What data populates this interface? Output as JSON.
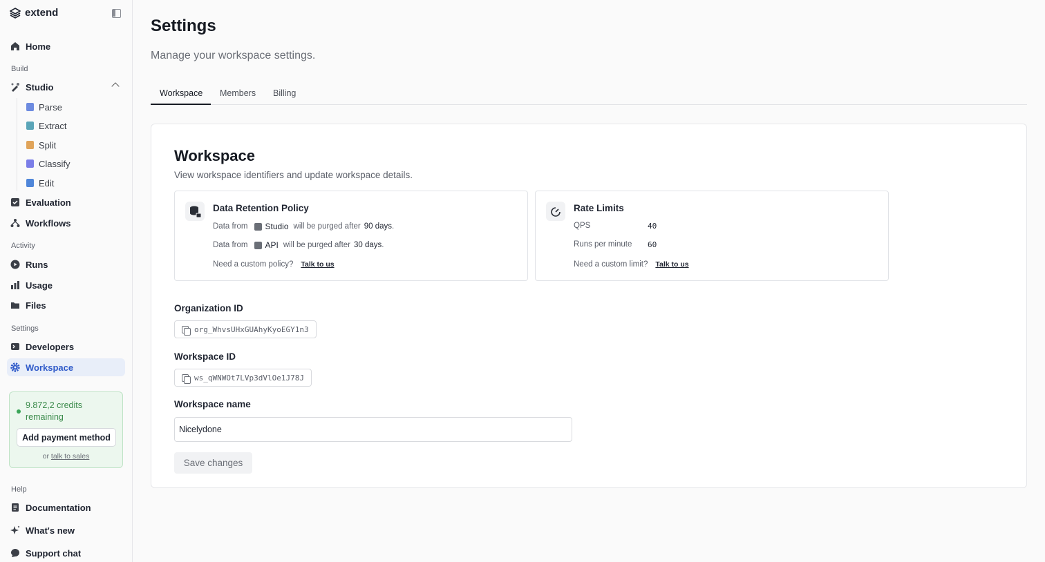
{
  "sidebar": {
    "brand": "extend",
    "items": {
      "home": "Home",
      "build_label": "Build",
      "studio": "Studio",
      "parse": "Parse",
      "extract": "Extract",
      "split": "Split",
      "classify": "Classify",
      "edit": "Edit",
      "evaluation": "Evaluation",
      "workflows": "Workflows",
      "activity_label": "Activity",
      "runs": "Runs",
      "usage": "Usage",
      "files": "Files",
      "settings_label": "Settings",
      "developers": "Developers",
      "workspace": "Workspace",
      "help_label": "Help",
      "documentation": "Documentation",
      "whats_new": "What's new",
      "support_chat": "Support chat"
    },
    "credits": {
      "text": "9.872,2 credits remaining",
      "pay_button": "Add payment method",
      "or": "or",
      "sales_link": "talk to sales"
    }
  },
  "main": {
    "title": "Settings",
    "subtitle": "Manage your workspace settings.",
    "tabs": [
      "Workspace",
      "Members",
      "Billing"
    ],
    "card": {
      "title": "Workspace",
      "subtitle": "View workspace identifiers and update workspace details.",
      "retention": {
        "title": "Data Retention Policy",
        "data_from": "Data from",
        "studio": "Studio",
        "purged_after": "will be purged after",
        "studio_days": "90 days",
        "api": "API",
        "api_days": "30 days",
        "custom": "Need a custom policy?",
        "link": "Talk to us"
      },
      "rate_limits": {
        "title": "Rate Limits",
        "qps_label": "QPS",
        "qps_value": "40",
        "rpm_label": "Runs per minute",
        "rpm_value": "60",
        "custom": "Need a custom limit?",
        "link": "Talk to us"
      },
      "org_id_label": "Organization ID",
      "org_id": "org_WhvsUHxGUAhyKyoEGY1n3",
      "workspace_id_label": "Workspace ID",
      "workspace_id": "ws_qWNWOt7LVp3dVlOe1J78J",
      "name_label": "Workspace name",
      "name_value": "Nicelydone",
      "save_button": "Save changes"
    }
  },
  "colors": {
    "accent": "#2f5ac9",
    "credits_green": "#3a8a4a"
  }
}
